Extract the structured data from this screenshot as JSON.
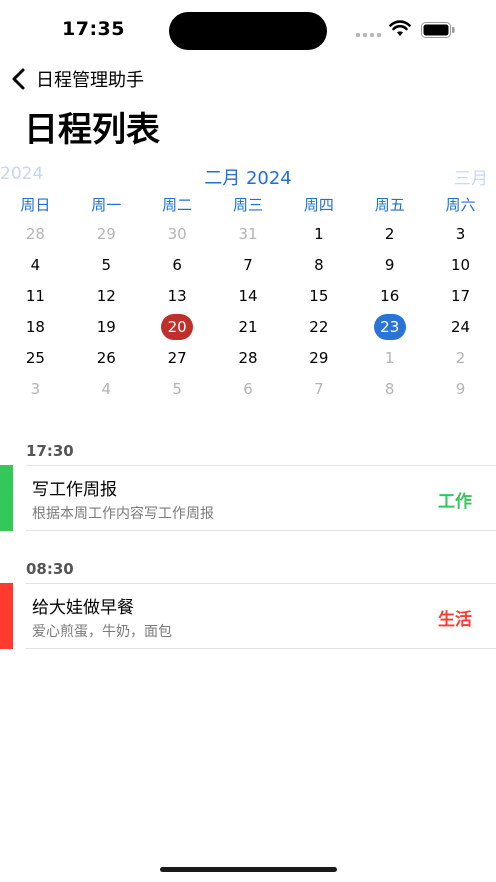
{
  "status_bar": {
    "time": "17:35"
  },
  "nav": {
    "back_label": "日程管理助手",
    "page_title": "日程列表"
  },
  "calendar": {
    "prev_month": "2024",
    "current_month": "二月 2024",
    "next_month": "三月",
    "weekdays": [
      "周日",
      "周一",
      "周二",
      "周三",
      "周四",
      "周五",
      "周六"
    ],
    "days": [
      {
        "n": "28",
        "s": "muted"
      },
      {
        "n": "29",
        "s": "muted"
      },
      {
        "n": "30",
        "s": "muted"
      },
      {
        "n": "31",
        "s": "muted"
      },
      {
        "n": "1",
        "s": "current"
      },
      {
        "n": "2",
        "s": "current"
      },
      {
        "n": "3",
        "s": "current"
      },
      {
        "n": "4",
        "s": "current"
      },
      {
        "n": "5",
        "s": "current"
      },
      {
        "n": "6",
        "s": "current"
      },
      {
        "n": "7",
        "s": "current"
      },
      {
        "n": "8",
        "s": "current"
      },
      {
        "n": "9",
        "s": "current"
      },
      {
        "n": "10",
        "s": "current"
      },
      {
        "n": "11",
        "s": "current"
      },
      {
        "n": "12",
        "s": "current"
      },
      {
        "n": "13",
        "s": "current"
      },
      {
        "n": "14",
        "s": "current"
      },
      {
        "n": "15",
        "s": "current"
      },
      {
        "n": "16",
        "s": "current"
      },
      {
        "n": "17",
        "s": "current"
      },
      {
        "n": "18",
        "s": "current"
      },
      {
        "n": "19",
        "s": "current"
      },
      {
        "n": "20",
        "s": "selected-red"
      },
      {
        "n": "21",
        "s": "current"
      },
      {
        "n": "22",
        "s": "current"
      },
      {
        "n": "23",
        "s": "selected-blue"
      },
      {
        "n": "24",
        "s": "current"
      },
      {
        "n": "25",
        "s": "current"
      },
      {
        "n": "26",
        "s": "current"
      },
      {
        "n": "27",
        "s": "current"
      },
      {
        "n": "28",
        "s": "current"
      },
      {
        "n": "29",
        "s": "current"
      },
      {
        "n": "1",
        "s": "muted"
      },
      {
        "n": "2",
        "s": "muted"
      },
      {
        "n": "3",
        "s": "muted"
      },
      {
        "n": "4",
        "s": "muted"
      },
      {
        "n": "5",
        "s": "muted"
      },
      {
        "n": "6",
        "s": "muted"
      },
      {
        "n": "7",
        "s": "muted"
      },
      {
        "n": "8",
        "s": "muted"
      },
      {
        "n": "9",
        "s": "muted"
      }
    ]
  },
  "events": [
    {
      "time": "17:30",
      "title": "写工作周报",
      "desc": "根据本周工作内容写工作周报",
      "tag": "工作",
      "color": "#34c759"
    },
    {
      "time": "08:30",
      "title": "给大娃做早餐",
      "desc": "爱心煎蛋，牛奶，面包",
      "tag": "生活",
      "color": "#ff3b30"
    }
  ],
  "colors": {
    "accent_blue": "#1f6fd6",
    "today_red": "#c0302b",
    "selected_blue": "#2a74d8"
  }
}
